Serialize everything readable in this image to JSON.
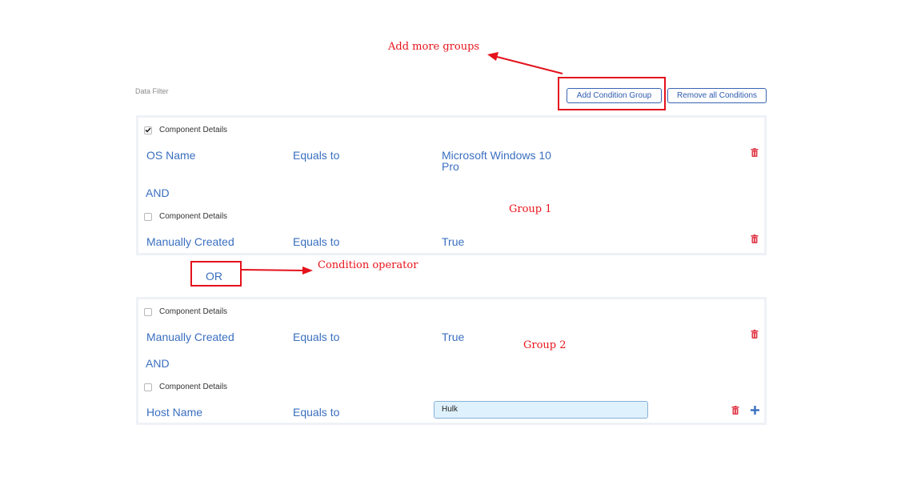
{
  "section_label": "Data Filter",
  "toolbar": {
    "add_group_label": "Add Condition Group",
    "remove_all_label": "Remove all Conditions"
  },
  "checkbox_label": "Component Details",
  "groups": [
    {
      "conditions": [
        {
          "checked": true,
          "field": "OS Name",
          "operator": "Equals to",
          "value": "Microsoft Windows 10 Pro"
        },
        {
          "checked": false,
          "field": "Manually Created",
          "operator": "Equals to",
          "value": "True"
        }
      ],
      "joiner": "AND"
    },
    {
      "conditions": [
        {
          "checked": false,
          "field": "Manually Created",
          "operator": "Equals to",
          "value": "True"
        },
        {
          "checked": false,
          "field": "Host Name",
          "operator": "Equals to",
          "value": "Hulk"
        }
      ],
      "joiner": "AND"
    }
  ],
  "group_operator": "OR",
  "annotations": {
    "add_more_groups": "Add more groups",
    "condition_operator": "Condition operator",
    "group1": "Group 1",
    "group2": "Group 2"
  },
  "colors": {
    "accent": "#3a6fc0",
    "annotation": "#e8141c",
    "delete": "#e03a4a",
    "input_bg": "#dff1fc"
  },
  "icons": {
    "delete": "trash-icon",
    "add": "plus-icon",
    "checkbox": "check-icon"
  }
}
